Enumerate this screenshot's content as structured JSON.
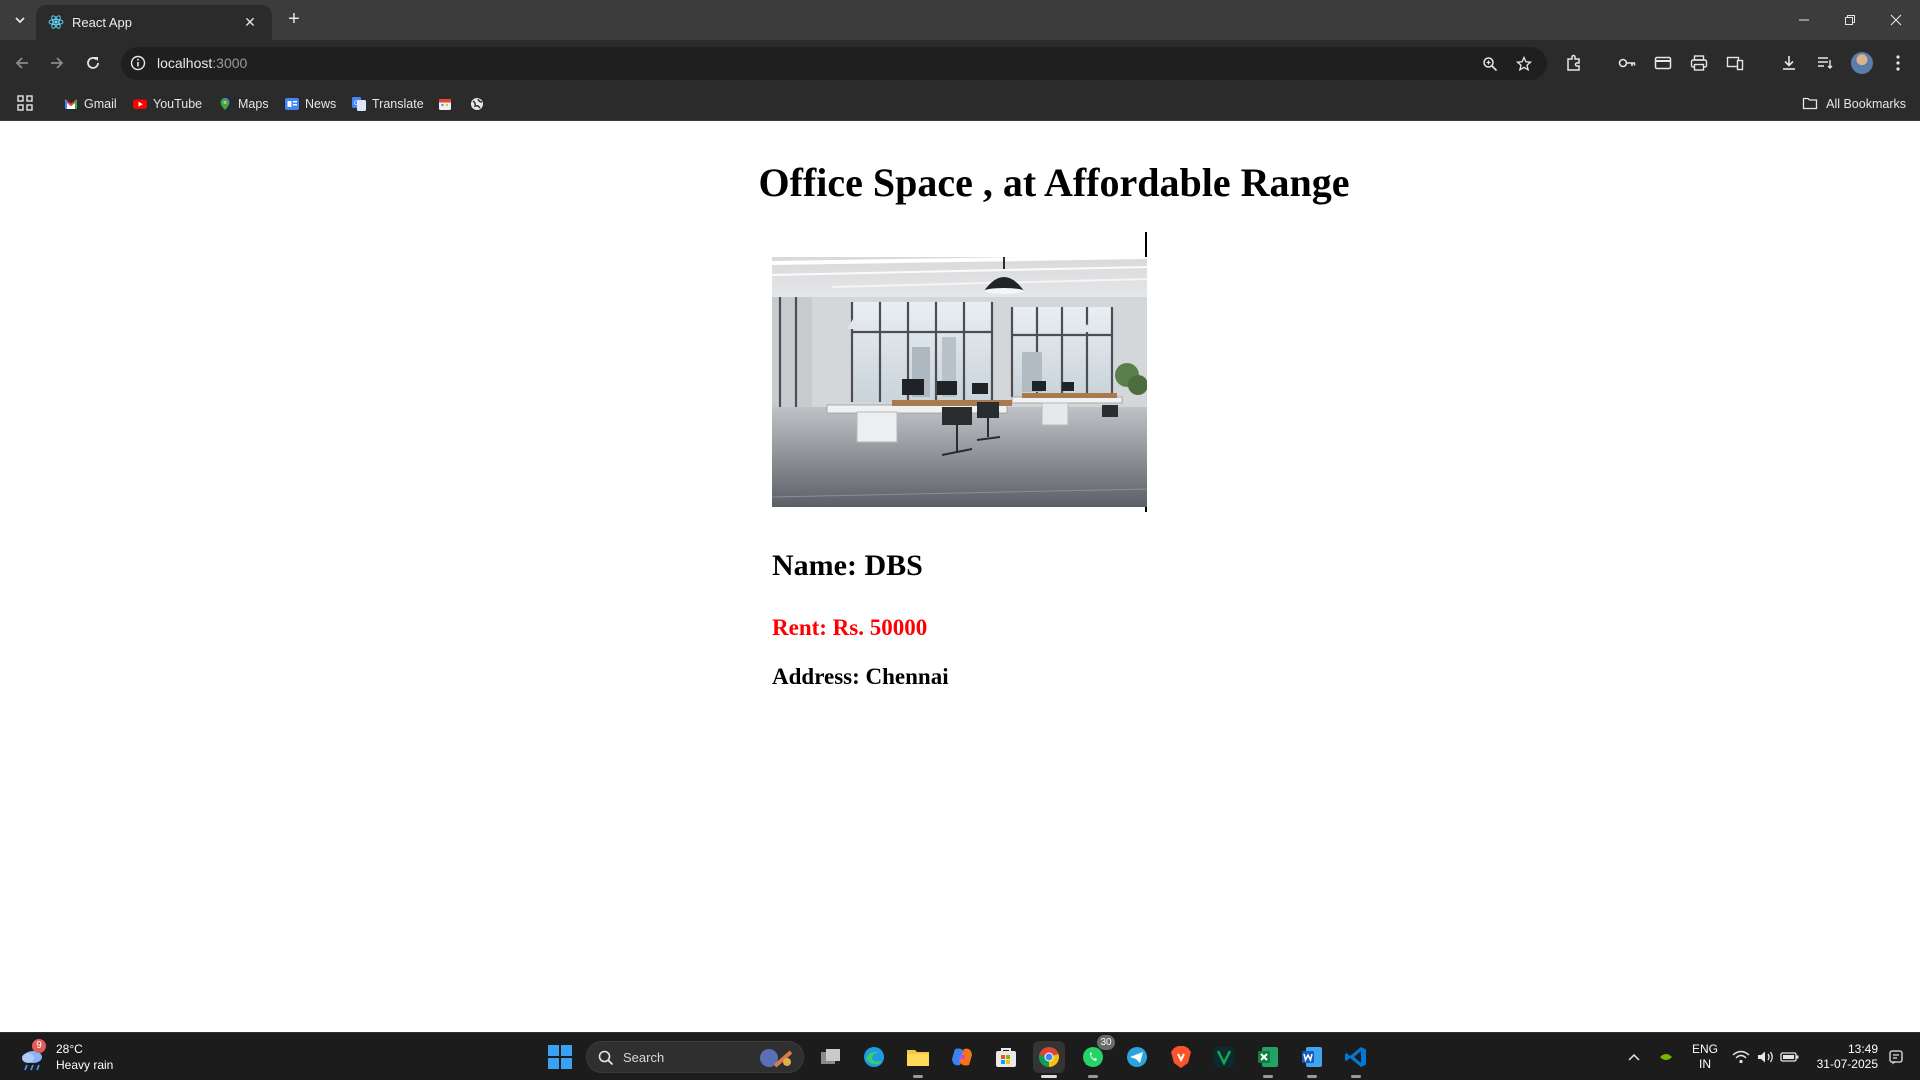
{
  "browser": {
    "tab": {
      "title": "React App"
    },
    "address": {
      "host": "localhost",
      "port": ":3000"
    },
    "bookmarks": [
      {
        "label": "Gmail",
        "icon": "gmail-icon"
      },
      {
        "label": "YouTube",
        "icon": "youtube-icon"
      },
      {
        "label": "Maps",
        "icon": "maps-icon"
      },
      {
        "label": "News",
        "icon": "news-icon"
      },
      {
        "label": "Translate",
        "icon": "translate-icon"
      }
    ],
    "all_bookmarks": "All Bookmarks"
  },
  "page": {
    "title": "Office Space , at Affordable Range",
    "office": {
      "name": "Name: DBS",
      "rent": "Rent: Rs. 50000",
      "address": "Address: Chennai",
      "rent_color": "#ff0000"
    }
  },
  "taskbar": {
    "weather": {
      "temp": "28°C",
      "condition": "Heavy rain",
      "badge": "9"
    },
    "search_label": "Search",
    "whatsapp_badge": "30",
    "language": {
      "line1": "ENG",
      "line2": "IN"
    },
    "clock": {
      "time": "13:49",
      "date": "31-07-2025"
    }
  }
}
